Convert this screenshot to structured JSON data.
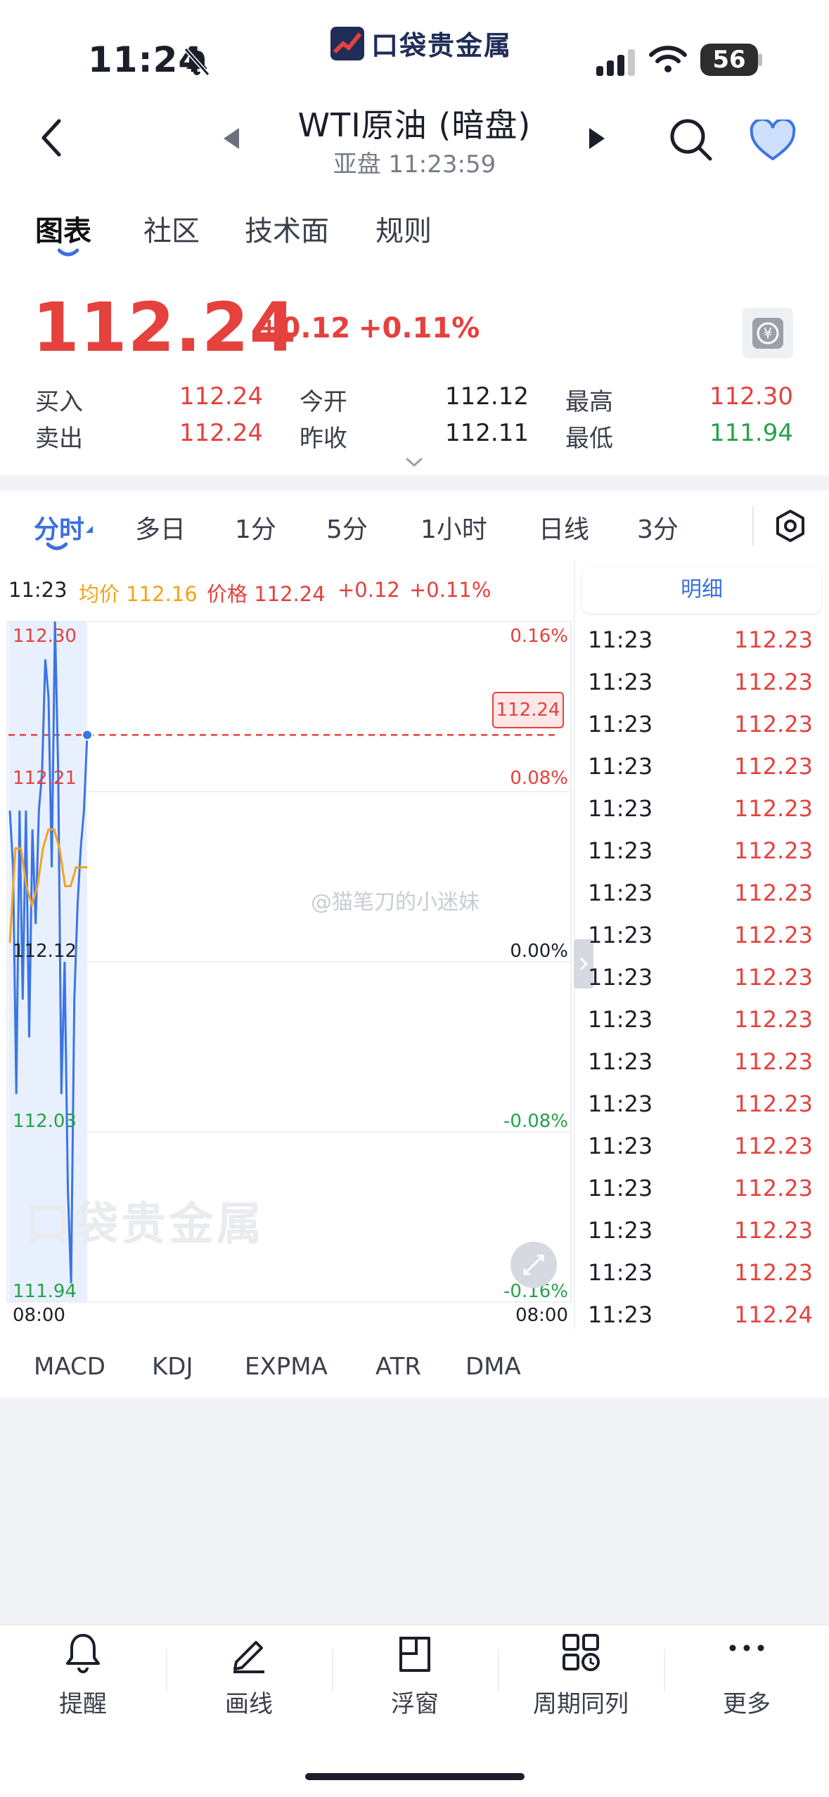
{
  "status_bar": {
    "time": "11:24",
    "battery": "56",
    "logo_text": "口袋贵金属"
  },
  "nav": {
    "title": "WTI原油 (暗盘)",
    "subtitle": "亚盘 11:23:59"
  },
  "tabs": [
    "图表",
    "社区",
    "技术面",
    "规则"
  ],
  "quote": {
    "price": "112.24",
    "change": "+0.12",
    "change_pct": "+0.11%",
    "buy_label": "买入",
    "buy": "112.24",
    "sell_label": "卖出",
    "sell": "112.24",
    "open_label": "今开",
    "open": "112.12",
    "prev_close_label": "昨收",
    "prev_close": "112.11",
    "high_label": "最高",
    "high": "112.30",
    "low_label": "最低",
    "low": "111.94"
  },
  "periods": [
    "分时",
    "多日",
    "1分",
    "5分",
    "1小时",
    "日线",
    "3分"
  ],
  "chart_info": {
    "time": "11:23",
    "avg_label": "均价 112.16",
    "price_label": "价格 112.24",
    "change": "+0.12",
    "change_pct": "+0.11%"
  },
  "chart_data": {
    "type": "line",
    "y_left_ticks": [
      "112.30",
      "112.21",
      "112.12",
      "112.03",
      "111.94"
    ],
    "y_right_ticks": [
      "0.16%",
      "0.08%",
      "0.00%",
      "-0.08%",
      "-0.16%"
    ],
    "x_ticks": [
      "08:00",
      "08:00"
    ],
    "ylim": [
      111.94,
      112.3
    ],
    "current_price_tag": "112.24",
    "series": [
      {
        "values": [
          112.2,
          112.17,
          112.05,
          112.2,
          112.1,
          112.2,
          112.08,
          112.19,
          112.14,
          112.2,
          112.22,
          112.28,
          112.26,
          112.17,
          112.3,
          112.22,
          112.05,
          112.12,
          112.0,
          111.95,
          112.1,
          112.15,
          112.18,
          112.2,
          112.24
        ]
      },
      {
        "values": [
          112.13,
          112.18,
          112.18,
          112.16,
          112.15,
          112.16,
          112.18,
          112.19,
          112.19,
          112.18,
          112.16,
          112.16,
          112.17,
          112.17,
          112.17
        ]
      }
    ],
    "colors": {
      "price": "#3b74e6",
      "avg": "#f2a31f",
      "up": "#e5413d",
      "down": "#25a24a"
    }
  },
  "watermark": "@猫笔刀的小迷妹",
  "detail": {
    "title": "明细",
    "rows": [
      {
        "t": "11:23",
        "p": "112.23"
      },
      {
        "t": "11:23",
        "p": "112.23"
      },
      {
        "t": "11:23",
        "p": "112.23"
      },
      {
        "t": "11:23",
        "p": "112.23"
      },
      {
        "t": "11:23",
        "p": "112.23"
      },
      {
        "t": "11:23",
        "p": "112.23"
      },
      {
        "t": "11:23",
        "p": "112.23"
      },
      {
        "t": "11:23",
        "p": "112.23"
      },
      {
        "t": "11:23",
        "p": "112.23"
      },
      {
        "t": "11:23",
        "p": "112.23"
      },
      {
        "t": "11:23",
        "p": "112.23"
      },
      {
        "t": "11:23",
        "p": "112.23"
      },
      {
        "t": "11:23",
        "p": "112.23"
      },
      {
        "t": "11:23",
        "p": "112.23"
      },
      {
        "t": "11:23",
        "p": "112.23"
      },
      {
        "t": "11:23",
        "p": "112.23"
      },
      {
        "t": "11:23",
        "p": "112.24"
      }
    ]
  },
  "indicators": [
    "MACD",
    "KDJ",
    "EXPMA",
    "ATR",
    "DMA"
  ],
  "toolbar": [
    "提醒",
    "画线",
    "浮窗",
    "周期同列",
    "更多"
  ]
}
